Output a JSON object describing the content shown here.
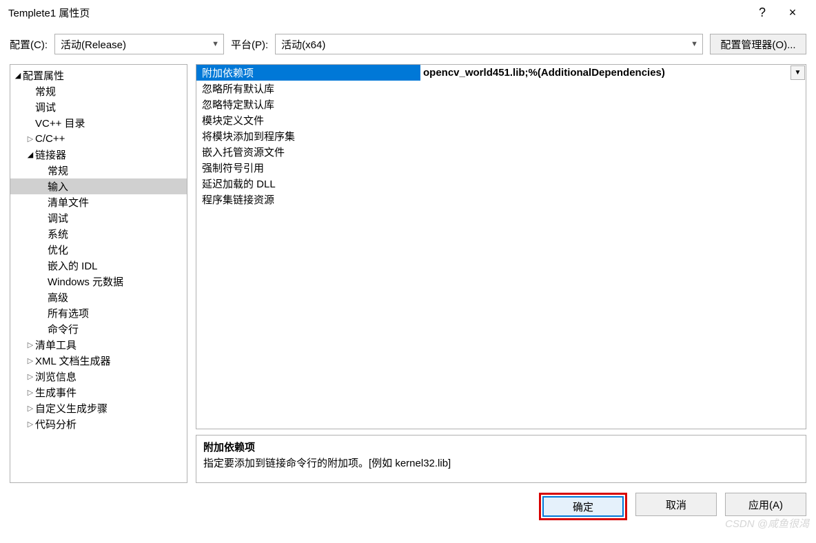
{
  "window": {
    "title": "Templete1 属性页",
    "help": "?",
    "close": "×"
  },
  "toolbar": {
    "config_label": "配置(C):",
    "config_value": "活动(Release)",
    "platform_label": "平台(P):",
    "platform_value": "活动(x64)",
    "manager_btn": "配置管理器(O)..."
  },
  "tree": [
    {
      "depth": 0,
      "arrow": "open",
      "label": "配置属性"
    },
    {
      "depth": 1,
      "arrow": "",
      "label": "常规"
    },
    {
      "depth": 1,
      "arrow": "",
      "label": "调试"
    },
    {
      "depth": 1,
      "arrow": "",
      "label": "VC++ 目录"
    },
    {
      "depth": 1,
      "arrow": "closed",
      "label": "C/C++"
    },
    {
      "depth": 1,
      "arrow": "open",
      "label": "链接器"
    },
    {
      "depth": 2,
      "arrow": "",
      "label": "常规"
    },
    {
      "depth": 2,
      "arrow": "",
      "label": "输入",
      "selected": true
    },
    {
      "depth": 2,
      "arrow": "",
      "label": "清单文件"
    },
    {
      "depth": 2,
      "arrow": "",
      "label": "调试"
    },
    {
      "depth": 2,
      "arrow": "",
      "label": "系统"
    },
    {
      "depth": 2,
      "arrow": "",
      "label": "优化"
    },
    {
      "depth": 2,
      "arrow": "",
      "label": "嵌入的 IDL"
    },
    {
      "depth": 2,
      "arrow": "",
      "label": "Windows 元数据"
    },
    {
      "depth": 2,
      "arrow": "",
      "label": "高级"
    },
    {
      "depth": 2,
      "arrow": "",
      "label": "所有选项"
    },
    {
      "depth": 2,
      "arrow": "",
      "label": "命令行"
    },
    {
      "depth": 1,
      "arrow": "closed",
      "label": "清单工具"
    },
    {
      "depth": 1,
      "arrow": "closed",
      "label": "XML 文档生成器"
    },
    {
      "depth": 1,
      "arrow": "closed",
      "label": "浏览信息"
    },
    {
      "depth": 1,
      "arrow": "closed",
      "label": "生成事件"
    },
    {
      "depth": 1,
      "arrow": "closed",
      "label": "自定义生成步骤"
    },
    {
      "depth": 1,
      "arrow": "closed",
      "label": "代码分析"
    }
  ],
  "grid": [
    {
      "key": "附加依赖项",
      "val": "opencv_world451.lib;%(AdditionalDependencies)",
      "selected": true
    },
    {
      "key": "忽略所有默认库",
      "val": ""
    },
    {
      "key": "忽略特定默认库",
      "val": ""
    },
    {
      "key": "模块定义文件",
      "val": ""
    },
    {
      "key": "将模块添加到程序集",
      "val": ""
    },
    {
      "key": "嵌入托管资源文件",
      "val": ""
    },
    {
      "key": "强制符号引用",
      "val": ""
    },
    {
      "key": "延迟加载的 DLL",
      "val": ""
    },
    {
      "key": "程序集链接资源",
      "val": ""
    }
  ],
  "desc": {
    "title": "附加依赖项",
    "text": "指定要添加到链接命令行的附加项。[例如 kernel32.lib]"
  },
  "footer": {
    "ok": "确定",
    "cancel": "取消",
    "apply": "应用(A)"
  },
  "watermark": "CSDN @咸鱼很渴"
}
